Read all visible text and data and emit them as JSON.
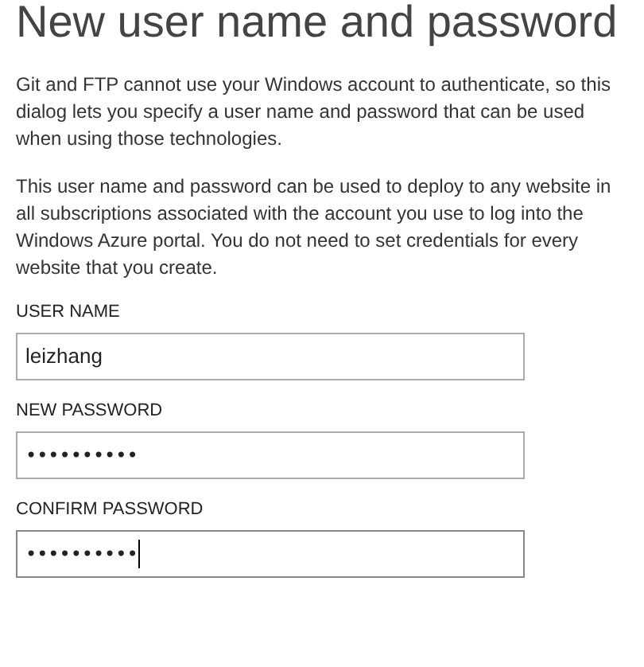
{
  "title": "New user name and password",
  "paragraphs": [
    "Git and FTP cannot use your Windows account to authenticate, so this dialog lets you specify a user name and password that can be used when using those technologies.",
    "This user name and password can be used to deploy to any website in all subscriptions associated with the account you use to log into the Windows Azure portal. You do not need to set credentials for every website that you create."
  ],
  "fields": [
    {
      "label": "USER NAME",
      "kind": "text",
      "value": "leizhang",
      "focused": false
    },
    {
      "label": "NEW PASSWORD",
      "kind": "password",
      "value": "••••••••••",
      "focused": false
    },
    {
      "label": "CONFIRM PASSWORD",
      "kind": "password",
      "value": "••••••••••",
      "focused": true
    }
  ]
}
